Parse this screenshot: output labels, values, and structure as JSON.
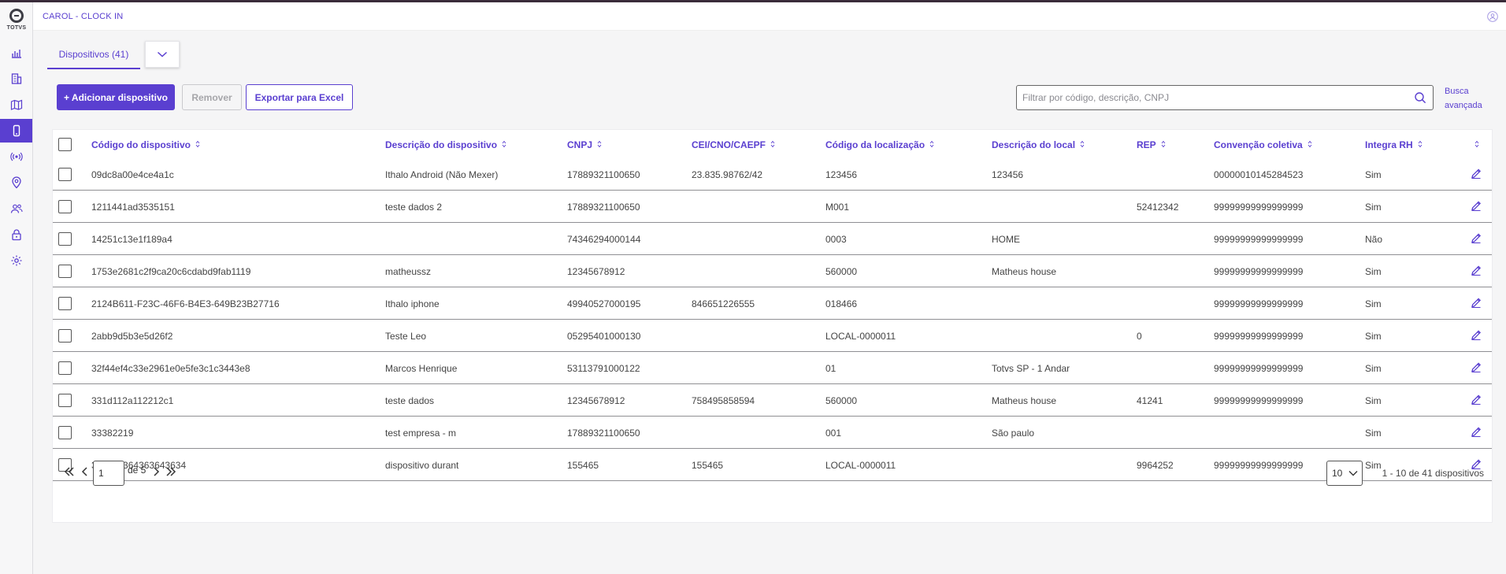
{
  "app": {
    "logo_text": "TOTVS",
    "title": "CAROL - CLOCK IN",
    "accent": "#5a3fd0"
  },
  "sidebar": {
    "items": [
      {
        "icon": "chart-icon",
        "active": false
      },
      {
        "icon": "building-icon",
        "active": false
      },
      {
        "icon": "map-icon",
        "active": false
      },
      {
        "icon": "device-icon",
        "active": true
      },
      {
        "icon": "broadcast-icon",
        "active": false
      },
      {
        "icon": "location-pin-icon",
        "active": false
      },
      {
        "icon": "users-icon",
        "active": false
      },
      {
        "icon": "lock-icon",
        "active": false
      },
      {
        "icon": "gear-icon",
        "active": false
      }
    ]
  },
  "tabs": {
    "active_label": "Dispositivos (41)"
  },
  "toolbar": {
    "add_label": "+ Adicionar dispositivo",
    "remove_label": "Remover",
    "export_label": "Exportar para Excel",
    "search_placeholder": "Filtrar por código, descrição, CNPJ",
    "search_value": "",
    "advanced_line1": "Busca",
    "advanced_line2": "avançada"
  },
  "table": {
    "columns": [
      "Código do dispositivo",
      "Descrição do dispositivo",
      "CNPJ",
      "CEI/CNO/CAEPF",
      "Código da localização",
      "Descrição do local",
      "REP",
      "Convenção coletiva",
      "Integra RH"
    ],
    "rows": [
      [
        "09dc8a00e4ce4a1c",
        "Ithalo Android (Não Mexer)",
        "17889321100650",
        "23.835.98762/42",
        "123456",
        "123456",
        "",
        "00000010145284523",
        "Sim"
      ],
      [
        "1211441ad3535151",
        "teste dados 2",
        "17889321100650",
        "",
        "M001",
        "",
        "52412342",
        "99999999999999999",
        "Sim"
      ],
      [
        "14251c13e1f189a4",
        "",
        "74346294000144",
        "",
        "0003",
        "HOME",
        "",
        "99999999999999999",
        "Não"
      ],
      [
        "1753e2681c2f9ca20c6cdabd9fab1119",
        "matheussz",
        "12345678912",
        "",
        "560000",
        "Matheus house",
        "",
        "99999999999999999",
        "Sim"
      ],
      [
        "2124B611-F23C-46F6-B4E3-649B23B27716",
        "Ithalo iphone",
        "49940527000195",
        "846651226555",
        "018466",
        "",
        "",
        "99999999999999999",
        "Sim"
      ],
      [
        "2abb9d5b3e5d26f2",
        "Teste Leo",
        "05295401000130",
        "",
        "LOCAL-0000011",
        "",
        "0",
        "99999999999999999",
        "Sim"
      ],
      [
        "32f44ef4c33e2961e0e5fe3c1c3443e8",
        "Marcos Henrique",
        "53113791000122",
        "",
        "01",
        "Totvs SP - 1 Andar",
        "",
        "99999999999999999",
        "Sim"
      ],
      [
        "331d112a112212c1",
        "teste dados",
        "12345678912",
        "758495858594",
        "560000",
        "Matheus house",
        "41241",
        "99999999999999999",
        "Sim"
      ],
      [
        "33382219",
        "test empresa - m",
        "17889321100650",
        "",
        "001",
        "São paulo",
        "",
        "",
        "Sim"
      ],
      [
        "342432364363643634",
        "dispositivo durant",
        "155465",
        "155465",
        "LOCAL-0000011",
        "",
        "9964252",
        "99999999999999999",
        "Sim"
      ]
    ]
  },
  "pagination": {
    "current_page": "1",
    "of_label": "de 5",
    "page_size": "10",
    "range_label": "1 - 10 de 41 dispositivos"
  }
}
